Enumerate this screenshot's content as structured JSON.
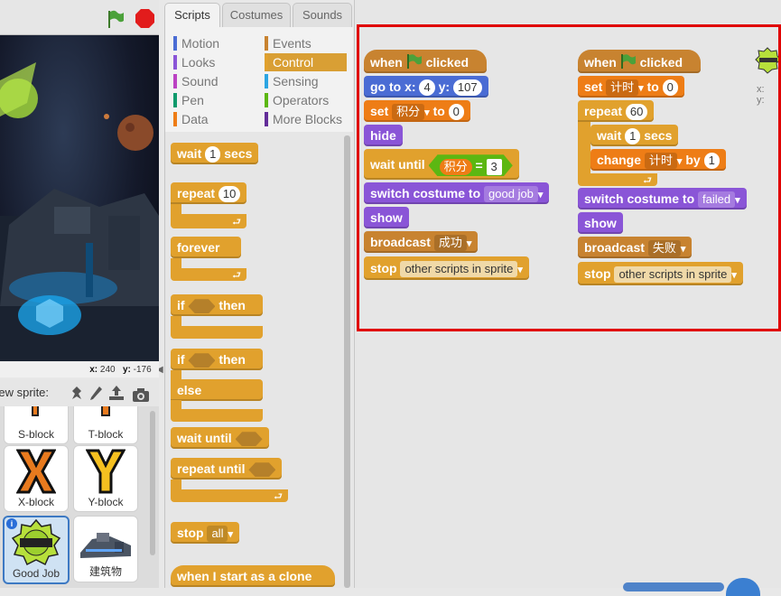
{
  "tabs": [
    "Scripts",
    "Costumes",
    "Sounds"
  ],
  "active_tab": "Scripts",
  "categories": [
    {
      "label": "Motion",
      "color": "#4a6cd4"
    },
    {
      "label": "Events",
      "color": "#c88330"
    },
    {
      "label": "Looks",
      "color": "#8a55d7"
    },
    {
      "label": "Control",
      "color": "#e1a12d"
    },
    {
      "label": "Sound",
      "color": "#bb42c3"
    },
    {
      "label": "Sensing",
      "color": "#2ca5e2"
    },
    {
      "label": "Pen",
      "color": "#0e9a6c"
    },
    {
      "label": "Operators",
      "color": "#5cb712"
    },
    {
      "label": "Data",
      "color": "#ee7d16"
    },
    {
      "label": "More Blocks",
      "color": "#632d99"
    }
  ],
  "active_category": "Control",
  "stage": {
    "coords_x_label": "x:",
    "coords_x": "240",
    "coords_y_label": "y:",
    "coords_y": "-176"
  },
  "new_sprite_label": "New sprite:",
  "sprites": [
    {
      "name": "S-block"
    },
    {
      "name": "T-block"
    },
    {
      "name": "X-block"
    },
    {
      "name": "Y-block"
    },
    {
      "name": "Good Job"
    },
    {
      "name": "建筑物"
    }
  ],
  "palette": {
    "wait": "wait",
    "wait_num": "1",
    "wait_secs": "secs",
    "repeat": "repeat",
    "repeat_num": "10",
    "forever": "forever",
    "if": "if",
    "then": "then",
    "else": "else",
    "wait_until": "wait until",
    "repeat_until": "repeat until",
    "stop": "stop",
    "stop_opt": "all",
    "clone": "when I start as a clone"
  },
  "script1": {
    "when": "when",
    "clicked": "clicked",
    "goto": "go to x:",
    "goto_x": "4",
    "goto_y_label": "y:",
    "goto_y": "107",
    "set": "set",
    "set_var": "积分",
    "to": "to",
    "set_val": "0",
    "hide": "hide",
    "wait_until": "wait until",
    "op_var": "积分",
    "op_eq": "=",
    "op_val": "3",
    "switch": "switch costume to",
    "costume": "good job",
    "show": "show",
    "broadcast": "broadcast",
    "message": "成功",
    "stop": "stop",
    "stop_opt": "other scripts in sprite"
  },
  "script2": {
    "when": "when",
    "clicked": "clicked",
    "set": "set",
    "set_var": "计时",
    "to": "to",
    "set_val": "0",
    "repeat": "repeat",
    "repeat_num": "60",
    "wait": "wait",
    "wait_num": "1",
    "wait_secs": "secs",
    "change": "change",
    "change_var": "计时",
    "by": "by",
    "change_val": "1",
    "switch": "switch costume to",
    "costume": "failed",
    "show": "show",
    "broadcast": "broadcast",
    "message": "失败",
    "stop": "stop",
    "stop_opt": "other scripts in sprite"
  },
  "sprite_info": {
    "x": "x:",
    "y": "y:"
  }
}
